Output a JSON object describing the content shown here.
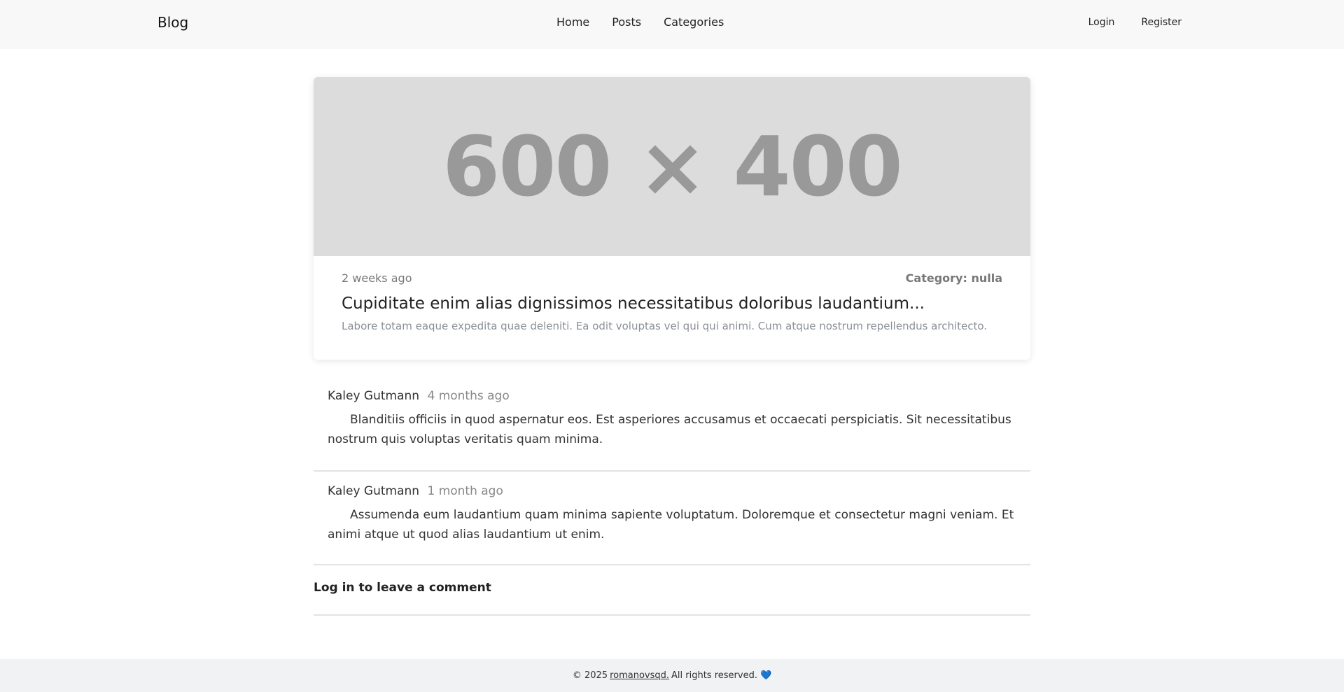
{
  "nav": {
    "brand": "Blog",
    "links": [
      "Home",
      "Posts",
      "Categories"
    ],
    "auth": [
      "Login",
      "Register"
    ]
  },
  "post": {
    "image_placeholder": "600 × 400",
    "date": "2 weeks ago",
    "category": "Category: nulla",
    "title": "Cupiditate enim alias dignissimos necessitatibus doloribus laudantium...",
    "excerpt": "Labore totam eaque expedita quae deleniti. Ea odit voluptas vel qui qui animi. Cum atque nostrum repellendus architecto."
  },
  "comments": [
    {
      "author": "Kaley Gutmann",
      "time": "4 months ago",
      "text": "Blanditiis officiis in quod aspernatur eos. Est asperiores accusamus et occaecati perspiciatis. Sit necessitatibus nostrum quis voluptas veritatis quam minima."
    },
    {
      "author": "Kaley Gutmann",
      "time": "1 month ago",
      "text": "Assumenda eum laudantium quam minima sapiente voluptatum. Doloremque et consectetur magni veniam. Et animi atque ut quod alias laudantium ut enim."
    }
  ],
  "login_prompt": "Log in to leave a comment",
  "footer": {
    "prefix": "© 2025",
    "author_link": "romanovsqd.",
    "suffix": "All rights reserved.",
    "heart": "💙"
  },
  "colors": {
    "navbar_bg": "#f8f8f8",
    "image_placeholder_bg": "#dcdcdc",
    "footer_bg": "#f1f2f4"
  }
}
